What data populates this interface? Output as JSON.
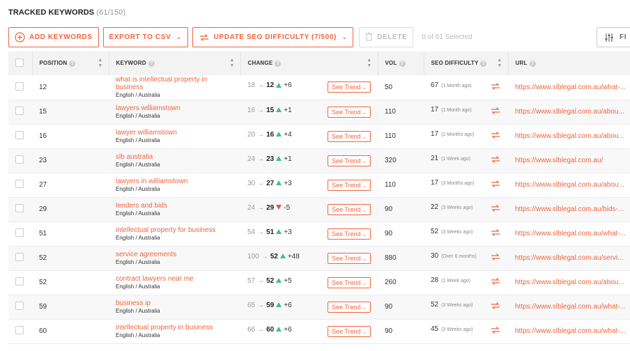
{
  "header": {
    "title": "TRACKED KEYWORDS",
    "count": "(61/150)"
  },
  "toolbar": {
    "add_keywords": "ADD KEYWORDS",
    "export_csv": "EXPORT TO CSV",
    "update_seo": "UPDATE SEO DIFFICULTY (7/500)",
    "delete": "DELETE",
    "selected": "0 of 61 Selected",
    "filter": "FI"
  },
  "colors": {
    "accent": "#f0643c",
    "up": "#3dbf8a",
    "down": "#e94e4e"
  },
  "columns": {
    "position": "POSITION",
    "keyword": "KEYWORD",
    "change": "CHANGE",
    "vol": "VOL",
    "seo": "SEO DIFFICULTY",
    "url": "URL"
  },
  "trend_label": "See Trend",
  "rows": [
    {
      "position": "12",
      "keyword": "what is intellectual property in business",
      "lang": "English / Australia",
      "from": "18",
      "to": "12",
      "dir": "up",
      "delta": "+6",
      "vol": "50",
      "seo": "67",
      "ago": "(1 Month ago)",
      "url": "https://www.slblegal.com.au/what-..."
    },
    {
      "position": "15",
      "keyword": "lawyers williamstown",
      "lang": "English / Australia",
      "from": "16",
      "to": "15",
      "dir": "up",
      "delta": "+1",
      "vol": "110",
      "seo": "17",
      "ago": "(1 Month ago)",
      "url": "https://www.slblegal.com.au/abou..."
    },
    {
      "position": "16",
      "keyword": "lawyer williamstown",
      "lang": "English / Australia",
      "from": "20",
      "to": "16",
      "dir": "up",
      "delta": "+4",
      "vol": "110",
      "seo": "17",
      "ago": "(2 Months ago)",
      "url": "https://www.slblegal.com.au/abou..."
    },
    {
      "position": "23",
      "keyword": "slb australia",
      "lang": "English / Australia",
      "from": "24",
      "to": "23",
      "dir": "up",
      "delta": "+1",
      "vol": "320",
      "seo": "21",
      "ago": "(1 Week ago)",
      "url": "https://www.slblegal.com.au/"
    },
    {
      "position": "27",
      "keyword": "lawyers in williamstown",
      "lang": "English / Australia",
      "from": "30",
      "to": "27",
      "dir": "up",
      "delta": "+3",
      "vol": "110",
      "seo": "17",
      "ago": "(3 Months ago)",
      "url": "https://www.slblegal.com.au/abou..."
    },
    {
      "position": "29",
      "keyword": "tenders and bids",
      "lang": "English / Australia",
      "from": "24",
      "to": "29",
      "dir": "down",
      "delta": "-5",
      "vol": "90",
      "seo": "22",
      "ago": "(3 Weeks ago)",
      "url": "https://www.slblegal.com.au/bids-..."
    },
    {
      "position": "51",
      "keyword": "intellectual property for business",
      "lang": "English / Australia",
      "from": "54",
      "to": "51",
      "dir": "up",
      "delta": "+3",
      "vol": "90",
      "seo": "52",
      "ago": "(3 Weeks ago)",
      "url": "https://www.slblegal.com.au/what-..."
    },
    {
      "position": "52",
      "keyword": "service agreements",
      "lang": "English / Australia",
      "from": "100",
      "to": "52",
      "dir": "up",
      "delta": "+48",
      "vol": "880",
      "seo": "30",
      "ago": "(Over 6 months)",
      "url": "https://www.slblegal.com.au/servi..."
    },
    {
      "position": "52",
      "keyword": "contract lawyers near me",
      "lang": "English / Australia",
      "from": "57",
      "to": "52",
      "dir": "up",
      "delta": "+5",
      "vol": "260",
      "seo": "28",
      "ago": "(1 Week ago)",
      "url": "https://www.slblegal.com.au/abou..."
    },
    {
      "position": "59",
      "keyword": "business ip",
      "lang": "English / Australia",
      "from": "65",
      "to": "59",
      "dir": "up",
      "delta": "+6",
      "vol": "90",
      "seo": "52",
      "ago": "(3 Weeks ago)",
      "url": "https://www.slblegal.com.au/what-..."
    },
    {
      "position": "60",
      "keyword": "intellectual property in business",
      "lang": "English / Australia",
      "from": "66",
      "to": "60",
      "dir": "up",
      "delta": "+6",
      "vol": "90",
      "seo": "45",
      "ago": "(3 Weeks ago)",
      "url": "https://www.slblegal.com.au/what-..."
    }
  ]
}
